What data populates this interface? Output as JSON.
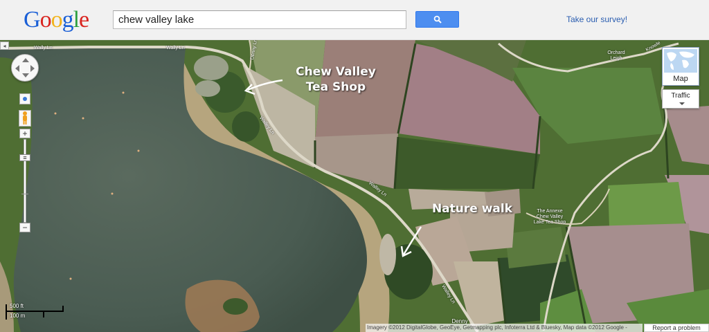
{
  "header": {
    "logo_text": "Google",
    "logo_letters": [
      {
        "char": "G",
        "color": "#1a5fd6"
      },
      {
        "char": "o",
        "color": "#d9241f"
      },
      {
        "char": "o",
        "color": "#f1b31c"
      },
      {
        "char": "g",
        "color": "#1a5fd6"
      },
      {
        "char": "l",
        "color": "#2c9f3e"
      },
      {
        "char": "e",
        "color": "#d9241f"
      }
    ],
    "search_value": "chew valley lake",
    "search_button_icon": "magnifier-icon",
    "survey_link": "Take our survey!"
  },
  "map": {
    "view": "satellite",
    "controls": {
      "collapse_toggle": "◂",
      "pan_icon": "pan-arrows-icon",
      "zoom_in": "+",
      "zoom_out": "−",
      "zoom_thumb": "≡",
      "maptype_label": "Map",
      "traffic_label": "Traffic"
    },
    "annotations": {
      "tea_shop": "Chew Valley\nTea Shop",
      "nature_walk": "Nature walk"
    },
    "places": {
      "annexe": "The Annexe\nChew Valley\nLake Tea Shop",
      "orchard": "Orchard\nLeigh",
      "denny": "Denny"
    },
    "roads": {
      "wally_ln_1": "Wally Ln",
      "wally_ln_2": "Wally Ln",
      "walley_ln_1": "Walley Ln",
      "walley_ln_2": "Walley Ln",
      "walley_ln_3": "Walley Ln",
      "denny_road": "Denny Ln",
      "knowle": "Knowle"
    },
    "scale": {
      "imperial": "500 ft",
      "metric": "100 m"
    },
    "attribution": "Imagery ©2012 DigitalGlobe, GeoEye, Getmapping plc, Infoterra Ltd & Bluesky, Map data ©2012 Google -",
    "report_problem": "Report a problem"
  }
}
